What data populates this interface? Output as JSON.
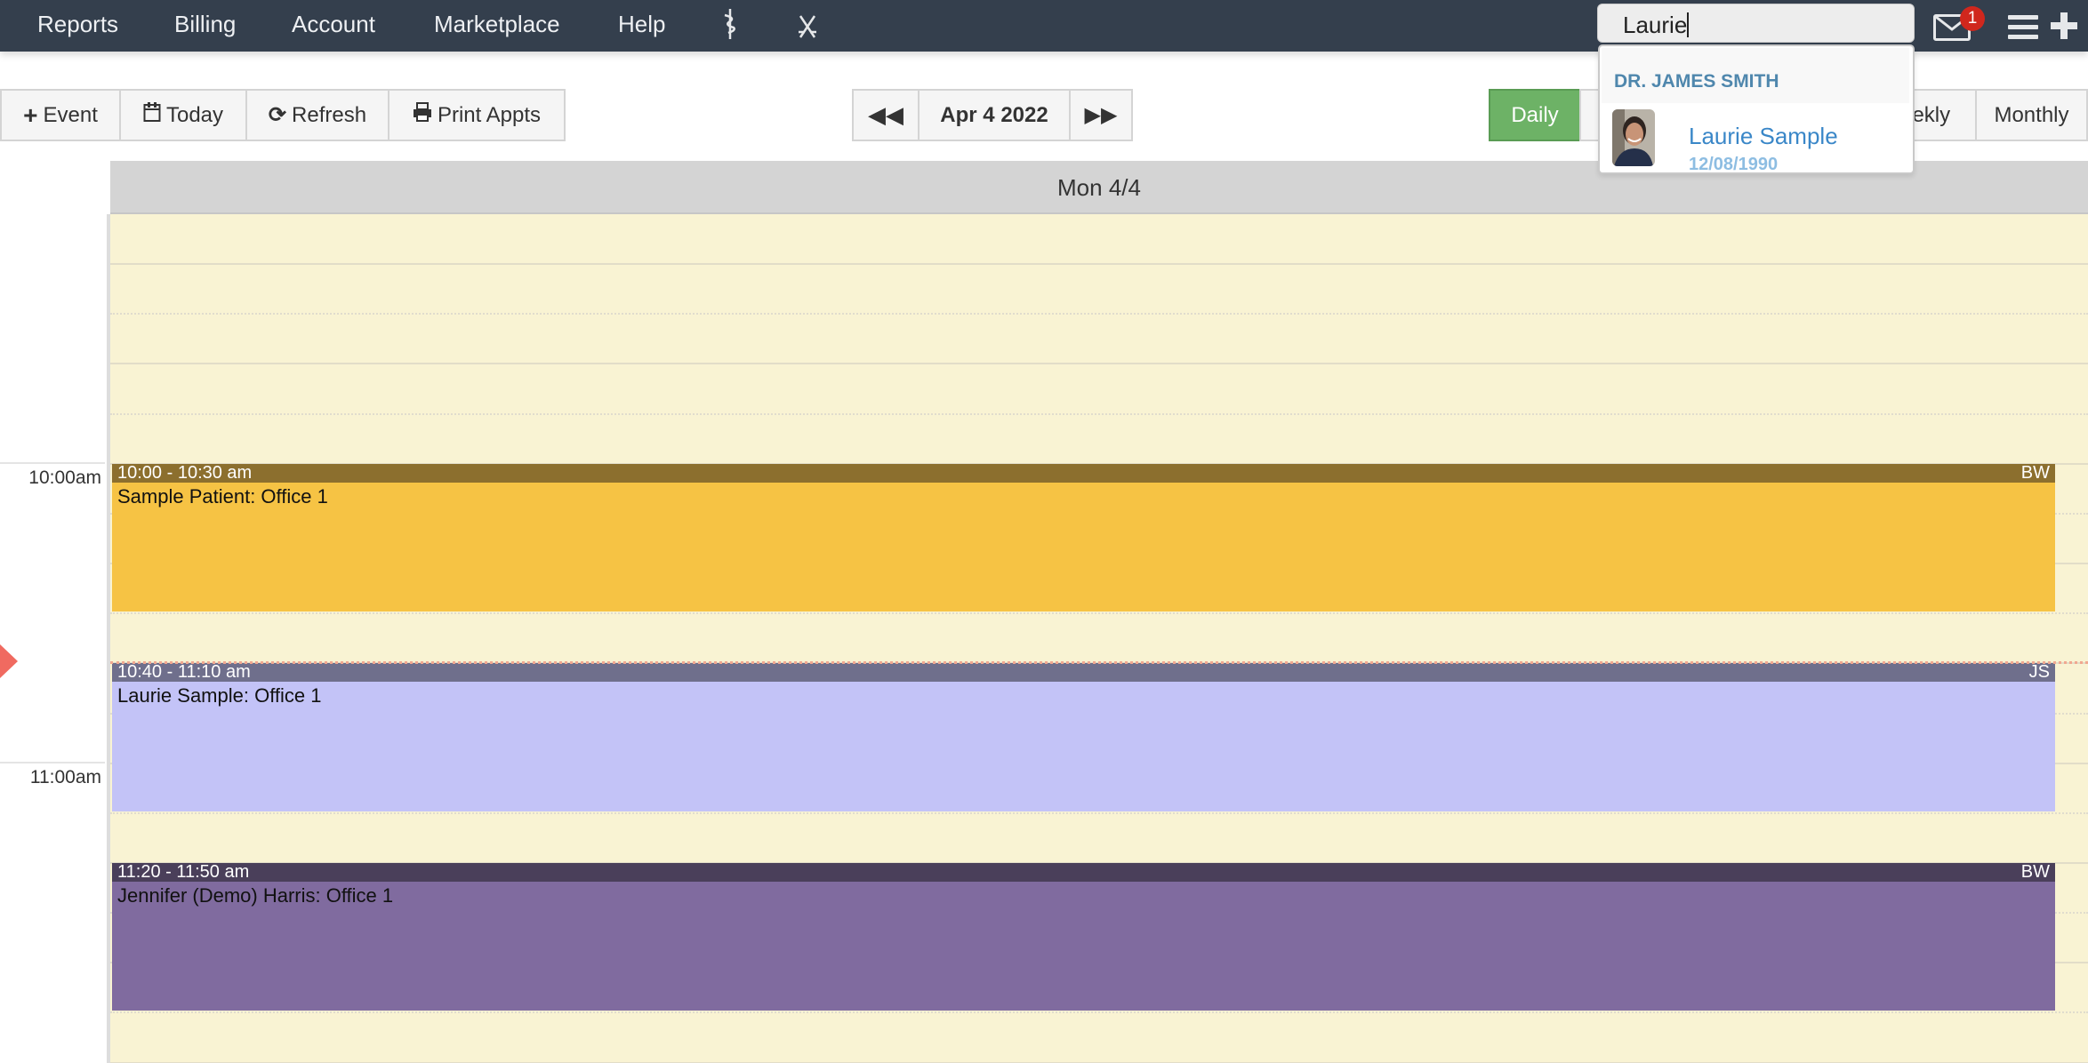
{
  "nav": {
    "items": [
      "Reports",
      "Billing",
      "Account",
      "Marketplace",
      "Help"
    ],
    "icons": [
      "caduceus-icon",
      "swords-icon"
    ],
    "search_value": "Laurie",
    "mail_badge": "1"
  },
  "toolbar": {
    "event": "Event",
    "today": "Today",
    "refresh": "Refresh",
    "print": "Print Appts",
    "date": "Apr 4 2022",
    "views": {
      "daily": "Daily",
      "weekly": "Weekly",
      "monthly": "Monthly"
    },
    "active_view": "Daily"
  },
  "calendar": {
    "day_header": "Mon 4/4",
    "time_labels": [
      {
        "label": "10:00am",
        "time": "10:00"
      },
      {
        "label": "11:00am",
        "time": "11:00"
      }
    ],
    "current_time": "10:41",
    "events": [
      {
        "time": "10:00 - 10:30 am",
        "start": "10:00",
        "end": "10:30",
        "title": "Sample Patient: Office 1",
        "initials": "BW",
        "header_color": "#8c6f2e",
        "body_color": "#f6c344"
      },
      {
        "time": "10:40 - 11:10 am",
        "start": "10:40",
        "end": "11:10",
        "title": "Laurie Sample: Office 1",
        "initials": "JS",
        "header_color": "#6f6f8c",
        "body_color": "#c3c3f7"
      },
      {
        "time": "11:20 - 11:50 am",
        "start": "11:20",
        "end": "11:50",
        "title": "Jennifer (Demo) Harris: Office 1",
        "initials": "BW",
        "header_color": "#4a3f5a",
        "body_color": "#806b9f"
      }
    ]
  },
  "search_dropdown": {
    "group": "DR. JAMES SMITH",
    "results": [
      {
        "name": "Laurie Sample",
        "dob": "12/08/1990"
      }
    ]
  },
  "colors": {
    "nav_bg": "#343f4d",
    "active_view": "#6db266",
    "grid_bg": "#f9f3d3",
    "now_indicator": "#f06a60"
  }
}
